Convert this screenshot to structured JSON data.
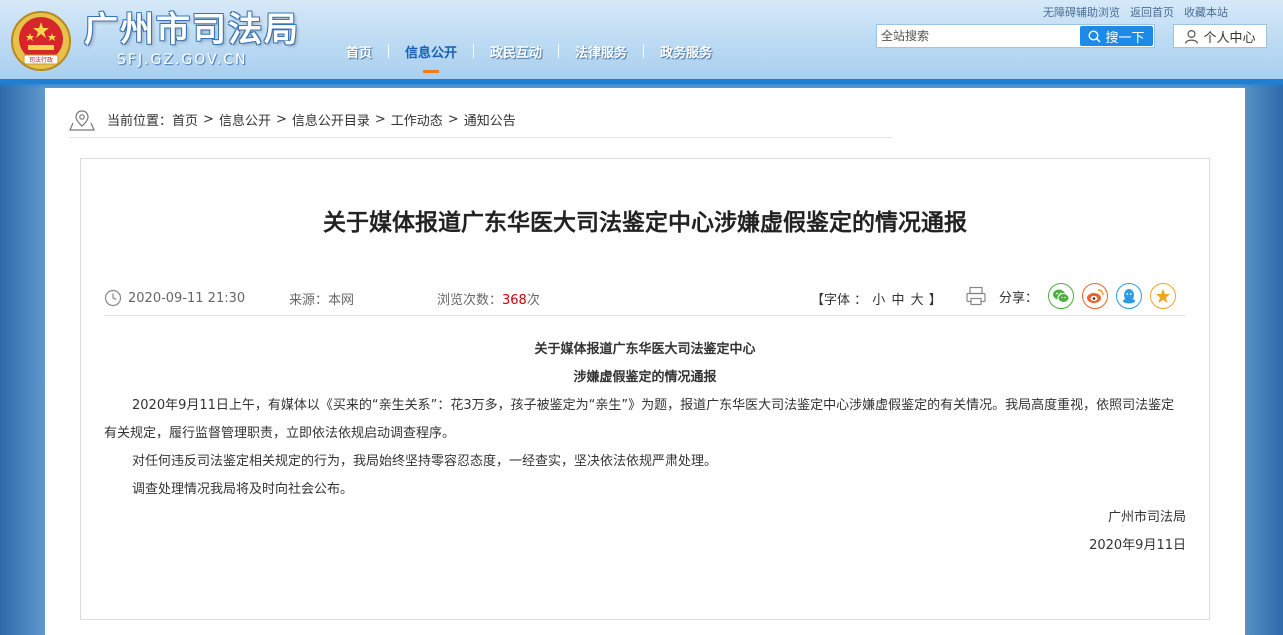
{
  "header": {
    "site_title": "广州市司法局",
    "site_domain": "SFJ.GZ.GOV.CN",
    "emblem_label": "司法行政",
    "nav": [
      {
        "label": "首页"
      },
      {
        "label": "信息公开"
      },
      {
        "label": "政民互动"
      },
      {
        "label": "法律服务"
      },
      {
        "label": "政务服务"
      }
    ],
    "active_nav_index": 1,
    "top_links": [
      "无障碍辅助浏览",
      "返回首页",
      "收藏本站"
    ],
    "search": {
      "placeholder": "全站搜索",
      "value": "",
      "button_label": "搜一下"
    },
    "user_center_label": "个人中心"
  },
  "breadcrumb": {
    "prefix": "当前位置：",
    "items": [
      "首页",
      "信息公开",
      "信息公开目录",
      "工作动态",
      "通知公告"
    ],
    "separator": ">"
  },
  "article": {
    "title": "关于媒体报道广东华医大司法鉴定中心涉嫌虚假鉴定的情况通报",
    "date": "2020-09-11 21:30",
    "source": "来源：本网",
    "views_label": "浏览次数：",
    "views_count": "368",
    "views_unit": "次",
    "font_size": {
      "open": "【字体 ：",
      "small": "小",
      "medium": "中",
      "large": "大",
      "close": "】"
    },
    "share_label": "分享：",
    "share_icons": [
      "wechat-icon",
      "weibo-icon",
      "qq-icon",
      "favorite-icon"
    ],
    "body": {
      "heading_line1": "关于媒体报道广东华医大司法鉴定中心",
      "heading_line2": "涉嫌虚假鉴定的情况通报",
      "paragraph1": "2020年9月11日上午，有媒体以《买来的“亲生关系”：花3万多，孩子被鉴定为“亲生”》为题，报道广东华医大司法鉴定中心涉嫌虚假鉴定的有关情况。我局高度重视，依照司法鉴定有关规定，履行监督管理职责，立即依法依规启动调查程序。",
      "paragraph2": "对任何违反司法鉴定相关规定的行为，我局始终坚持零容忍态度，一经查实，坚决依法依规严肃处理。",
      "paragraph3": "调查处理情况我局将及时向社会公布。",
      "signature": "广州市司法局",
      "sign_date": "2020年9月11日"
    }
  },
  "colors": {
    "nav_active": "#1a5fb4",
    "nav_underline": "#ef7b1a",
    "search_button": "#1c8ae6",
    "views_count": "#cc0000",
    "wechat": "#4caf3d",
    "weibo": "#e8642c",
    "qq": "#2b9be3",
    "favorite": "#f0a623"
  }
}
